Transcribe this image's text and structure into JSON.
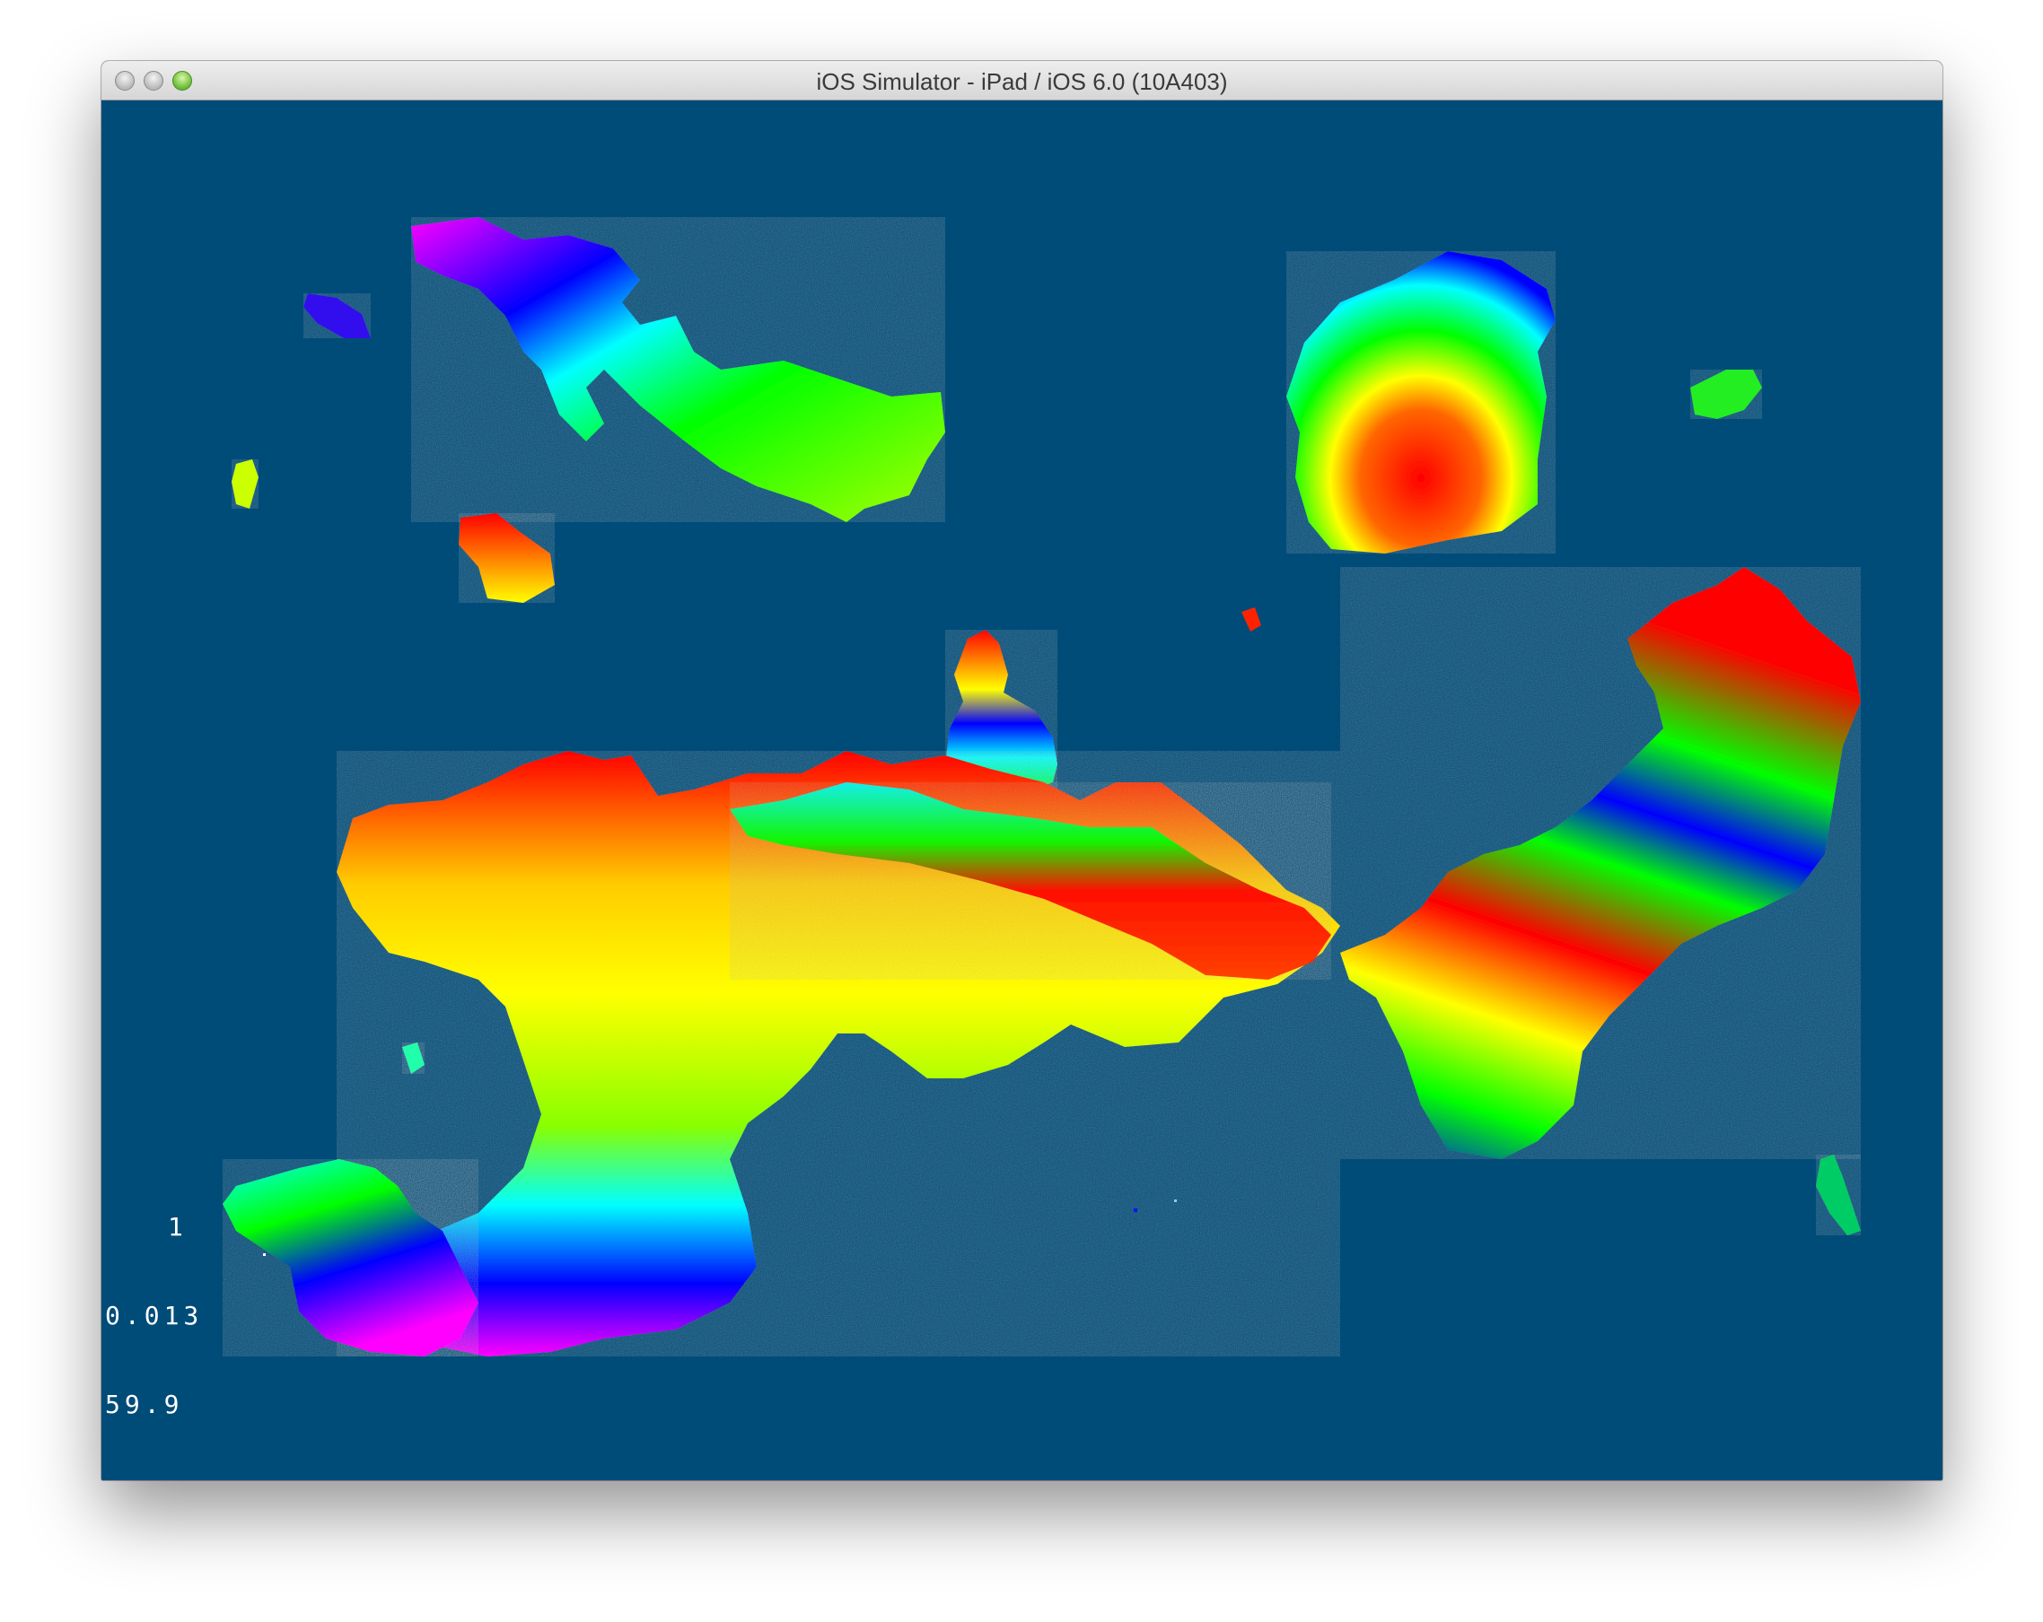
{
  "window": {
    "title": "iOS Simulator - iPad / iOS 6.0 (10A403)"
  },
  "stats": {
    "frames": "1",
    "frame_time": "0.013",
    "fps": "59.9"
  },
  "colors": {
    "water": "#004c79",
    "elevation_ramp": [
      "#ff00ff",
      "#0000ff",
      "#00ffff",
      "#00ff00",
      "#ffff00",
      "#ff0000"
    ]
  }
}
